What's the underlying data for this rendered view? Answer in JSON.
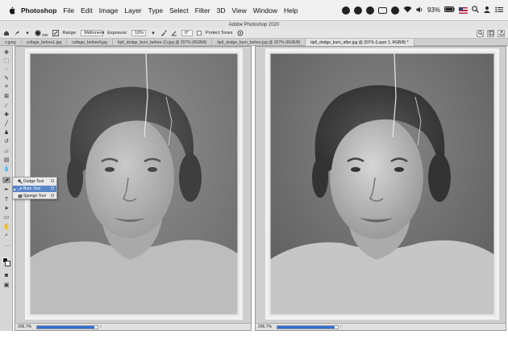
{
  "menubar": {
    "items": [
      "Photoshop",
      "File",
      "Edit",
      "Image",
      "Layer",
      "Type",
      "Select",
      "Filter",
      "3D",
      "View",
      "Window",
      "Help"
    ],
    "battery": "93%"
  },
  "app": {
    "title": "Adobe Photoshop 2020"
  },
  "options": {
    "brush_size": "400",
    "range_label": "Range:",
    "range_value": "Midtones",
    "exposure_label": "Exposure:",
    "exposure_value": "10%",
    "angle_value": "0°",
    "protect_tones_label": "Protect Tones"
  },
  "tabs": [
    {
      "label": "n.jpeg",
      "active": false
    },
    {
      "label": "collage_before1.jpg",
      "active": false
    },
    {
      "label": "collage_before4.jpg",
      "active": false
    },
    {
      "label": "tip6_dodge_burn_before (1).jpg @ 207% (RGB/8)",
      "active": false
    },
    {
      "label": "tip6_dodge_burn_before.jpg @ 207% (RGB/8)",
      "active": false
    },
    {
      "label": "tip6_dodge_burn_after.jpg @ 207% (Layer 1, RGB/8) *",
      "active": true
    }
  ],
  "flyout": {
    "items": [
      {
        "label": "Dodge Tool",
        "key": "O",
        "icon": "dodge-icon",
        "selected": false
      },
      {
        "label": "Burn Tool",
        "key": "O",
        "icon": "burn-icon",
        "selected": true
      },
      {
        "label": "Sponge Tool",
        "key": "O",
        "icon": "sponge-icon",
        "selected": false
      }
    ]
  },
  "docs": {
    "left": {
      "zoom": "206.7%",
      "progress": 0.95
    },
    "right": {
      "zoom": "206.7%",
      "progress": 0.95
    }
  },
  "colors": {
    "progress_fill": "#2f6fd8",
    "flyout_highlight": "#5a87c9"
  }
}
